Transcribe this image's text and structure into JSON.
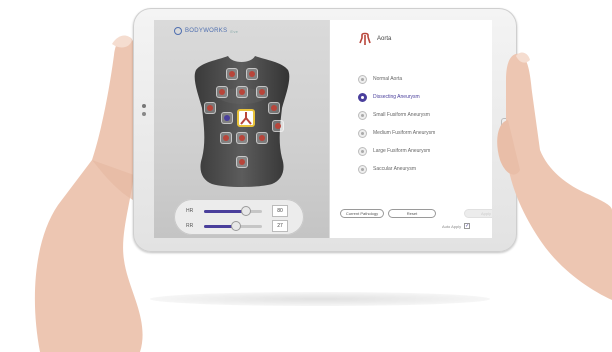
{
  "brand": {
    "name": "BODYWORKS",
    "suffix": "Eve"
  },
  "panel": {
    "title": "Aorta",
    "icon": "aorta-organ-icon"
  },
  "pathologies": [
    {
      "label": "Normal Aorta",
      "selected": false
    },
    {
      "label": "Dissecting Aneurysm",
      "selected": true
    },
    {
      "label": "Small Fusiform Aneurysm",
      "selected": false
    },
    {
      "label": "Medium Fusiform Aneurysm",
      "selected": false
    },
    {
      "label": "Large Fusiform Aneurysm",
      "selected": false
    },
    {
      "label": "Saccular Aneurysm",
      "selected": false
    }
  ],
  "buttons": {
    "current_pathology": "Current Pathology",
    "reset": "Reset",
    "apply": "Apply"
  },
  "auto_apply": {
    "label": "Auto Apply",
    "checked": true
  },
  "vitals": {
    "hr": {
      "label": "HR",
      "value": "80",
      "level": 0.72
    },
    "rr": {
      "label": "RR",
      "value": "27",
      "level": 0.55
    }
  },
  "colors": {
    "accent": "#4a3f9c",
    "highlight": "#e7c23a",
    "organ": "#b8453a"
  }
}
